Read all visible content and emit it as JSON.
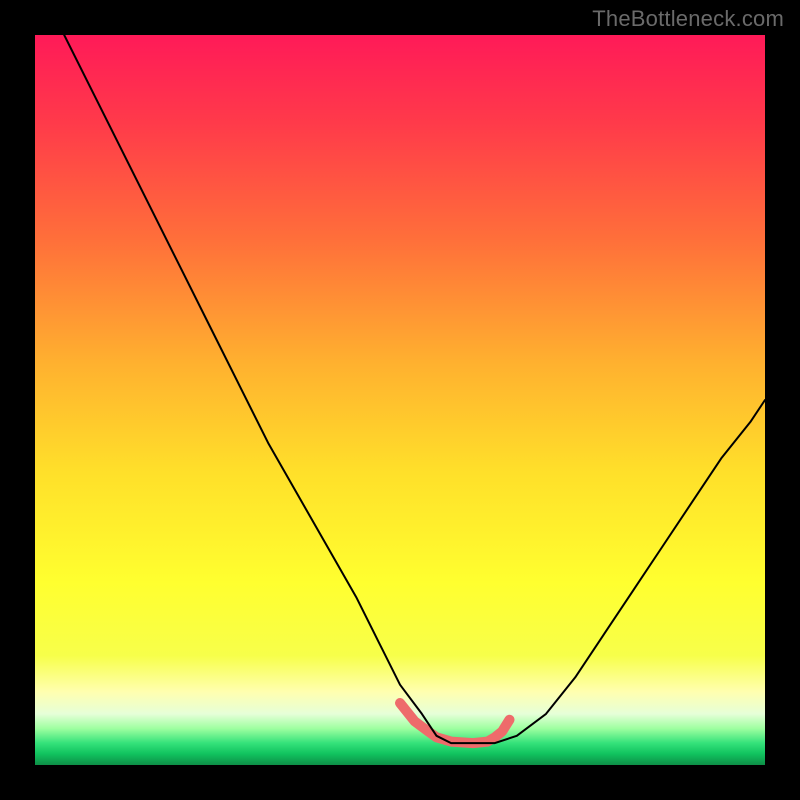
{
  "watermark": "TheBottleneck.com",
  "chart_data": {
    "type": "line",
    "title": "",
    "xlabel": "",
    "ylabel": "",
    "xlim": [
      0,
      100
    ],
    "ylim": [
      0,
      100
    ],
    "gradient_stops": [
      {
        "pct": 0,
        "color": "#ff1a58"
      },
      {
        "pct": 12,
        "color": "#ff3a4a"
      },
      {
        "pct": 28,
        "color": "#ff6f3a"
      },
      {
        "pct": 45,
        "color": "#ffb12f"
      },
      {
        "pct": 60,
        "color": "#ffe02a"
      },
      {
        "pct": 75,
        "color": "#ffff2f"
      },
      {
        "pct": 85,
        "color": "#f7ff4a"
      },
      {
        "pct": 90,
        "color": "#ffffb0"
      },
      {
        "pct": 93,
        "color": "#e6ffd8"
      },
      {
        "pct": 95,
        "color": "#9effa0"
      },
      {
        "pct": 97,
        "color": "#34e27a"
      },
      {
        "pct": 98.5,
        "color": "#10c25e"
      },
      {
        "pct": 100,
        "color": "#0e8f47"
      }
    ],
    "series": [
      {
        "name": "bottleneck-curve",
        "color": "#000000",
        "width": 2,
        "x": [
          4,
          8,
          12,
          16,
          20,
          24,
          28,
          32,
          36,
          40,
          44,
          47,
          50,
          53,
          55,
          57,
          60,
          63,
          66,
          70,
          74,
          78,
          82,
          86,
          90,
          94,
          98,
          100
        ],
        "y": [
          100,
          92,
          84,
          76,
          68,
          60,
          52,
          44,
          37,
          30,
          23,
          17,
          11,
          7,
          4,
          3,
          3,
          3,
          4,
          7,
          12,
          18,
          24,
          30,
          36,
          42,
          47,
          50
        ]
      },
      {
        "name": "sweet-spot-marker",
        "color": "#ee6b6b",
        "width": 10,
        "linecap": "round",
        "x": [
          50,
          52,
          54,
          55,
          57,
          60,
          62,
          63,
          64,
          65
        ],
        "y": [
          8.5,
          6.0,
          4.5,
          3.8,
          3.2,
          3.0,
          3.2,
          3.8,
          4.6,
          6.2
        ]
      }
    ]
  }
}
